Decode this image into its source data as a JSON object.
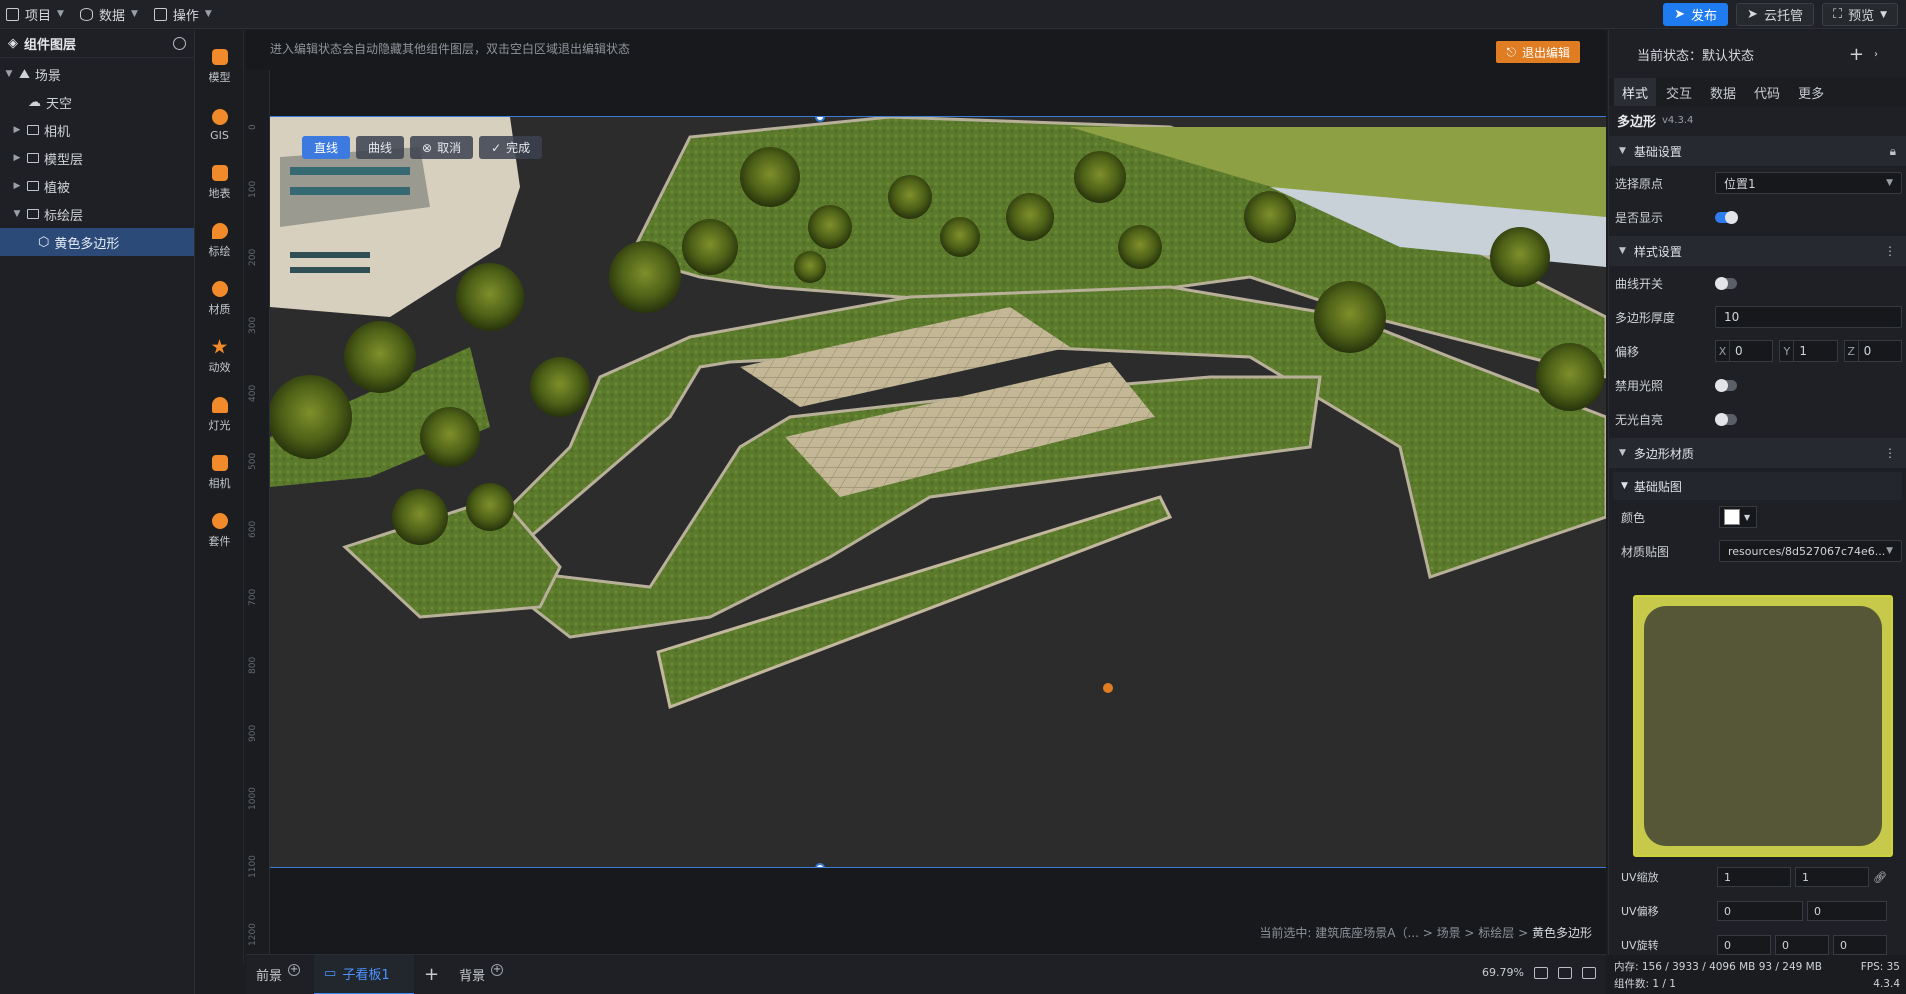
{
  "topbar": {
    "menus": [
      {
        "label": "项目"
      },
      {
        "label": "数据"
      },
      {
        "label": "操作"
      }
    ],
    "publish_label": "发布",
    "hosting_label": "云托管",
    "preview_label": "预览",
    "accent_color": "#1f7cf0"
  },
  "layers": {
    "title": "组件图层",
    "items": [
      {
        "label": "场景",
        "expanded": true
      },
      {
        "label": "天空"
      },
      {
        "label": "相机"
      },
      {
        "label": "模型层"
      },
      {
        "label": "植被"
      },
      {
        "label": "标绘层",
        "expanded": true
      },
      {
        "label": "黄色多边形",
        "selected": true
      }
    ]
  },
  "tools": [
    {
      "label": "模型"
    },
    {
      "label": "GIS"
    },
    {
      "label": "地表"
    },
    {
      "label": "标绘"
    },
    {
      "label": "材质"
    },
    {
      "label": "动效"
    },
    {
      "label": "灯光"
    },
    {
      "label": "相机"
    },
    {
      "label": "套件"
    }
  ],
  "stage": {
    "hint": "进入编辑状态会自动隐藏其他组件图层，双击空白区域退出编辑状态",
    "exit_label": "退出编辑",
    "exit_color": "#e07d22",
    "ruler_labels": [
      "0",
      "100",
      "200",
      "300",
      "400",
      "500",
      "600",
      "700",
      "800",
      "900",
      "1000",
      "1100",
      "1200"
    ],
    "edit_toolbar": {
      "line_label": "直线",
      "curve_label": "曲线",
      "cancel_label": "取消",
      "done_label": "完成"
    },
    "path_prefix": "当前选中: 建筑底座场景A（... > 场景 > 标绘层 >",
    "path_last": "黄色多边形"
  },
  "bottom": {
    "tabs": [
      {
        "label": "前景"
      },
      {
        "label": "子看板1",
        "active": true
      },
      {
        "label": "背景"
      }
    ],
    "zoom": "69.79%"
  },
  "props": {
    "state_label": "当前状态：默认状态",
    "tabs": [
      {
        "label": "样式",
        "active": true
      },
      {
        "label": "交互"
      },
      {
        "label": "数据"
      },
      {
        "label": "代码"
      },
      {
        "label": "更多"
      }
    ],
    "component_name": "多边形",
    "component_version": "v4.3.4",
    "basic_section": "基础设置",
    "origin_label": "选择原点",
    "origin_value": "位置1",
    "visible_label": "是否显示",
    "style_section": "样式设置",
    "curve_label": "曲线开关",
    "thickness_label": "多边形厚度",
    "thickness_value": "10",
    "offset_label": "偏移",
    "offset": {
      "x_label": "X",
      "x": "0",
      "y_label": "Y",
      "y": "1",
      "z_label": "Z",
      "z": "0"
    },
    "disable_light_label": "禁用光照",
    "no_glow_label": "无光自亮",
    "material_section": "多边形材质",
    "basic_map_label": "基础贴图",
    "color_label": "颜色",
    "color_value": "#ffffff",
    "texture_label": "材质贴图",
    "texture_value": "resources/8d527067c74e6...",
    "uv_scale_label": "UV缩放",
    "uv_scale": [
      "1",
      "1"
    ],
    "uv_offset_label": "UV偏移",
    "uv_offset": [
      "0",
      "0"
    ],
    "uv_rotate_label": "UV旋转",
    "uv_rotate": [
      "0",
      "0",
      "0"
    ]
  },
  "status": {
    "memory": "内存: 156 / 3933 / 4096 MB  93 / 249 MB",
    "fps": "FPS: 35",
    "components": "组件数: 1 / 1",
    "version": "4.3.4"
  }
}
